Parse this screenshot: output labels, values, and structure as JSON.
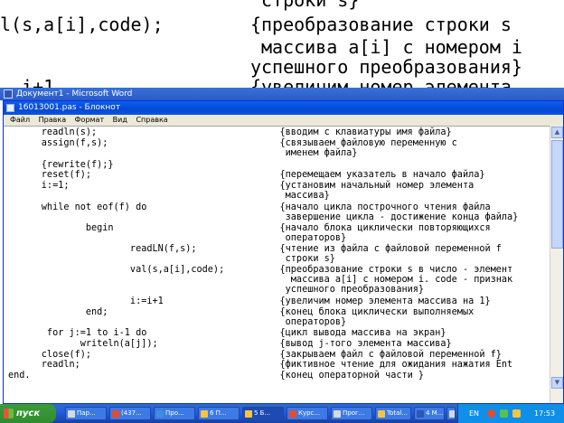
{
  "background_doc": {
    "lines": [
      "                        строки s}",
      "l(s,a[i],code);        {преобразование строки s",
      "                        массива a[i] с номером i",
      "                       успешного преобразования}",
      "  i+1                  {увеличим номер элемента"
    ]
  },
  "word_window": {
    "title": "Документ1 - Microsoft Word"
  },
  "notepad": {
    "title": "16013001.pas - Блокнот",
    "menu": [
      "Файл",
      "Правка",
      "Формат",
      "Вид",
      "Справка"
    ],
    "code_lines": [
      "      readln(s);                                 {вводим с клавиатуры имя файла}",
      "      assign(f,s);                               {связываем файловую переменную с",
      "                                                  именем файла}",
      "      {rewrite(f);}",
      "      reset(f);                                  {перемещаем указатель в начало файла}",
      "      i:=1;                                      {установим начальный номер элемента",
      "                                                  массива}",
      "      while not eof(f) do                        {начало цикла построчного чтения файла",
      "                                                  завершение цикла - достижение конца файла}",
      "              begin                              {начало блока циклически повторяющихся",
      "                                                  операторов}",
      "                      readLN(f,s);               {чтение из файла с файловой переменной f",
      "                                                  строки s}",
      "                      val(s,a[i],code);          {преобразование строки s в число - элемент",
      "                                                   массива a[i] с номером i. code - признак",
      "                                                  успешного преобразования}",
      "                      i:=i+1                     {увеличим номер элемента массива на 1}",
      "              end;                               {конец блока циклически выполняемых",
      "                                                  операторов}",
      "       for j:=1 to i-1 do                        {цикл вывода массива на экран}",
      "             writeln(a[j]);                      {вывод j-того элемента массива}",
      "      close(f);                                  {закрываем файл с файловой переменной f}",
      "      readln;                                    {фиктивное чтение для ожидания нажатия Ent",
      "end.                                             {конец операторной части }"
    ]
  },
  "taskbar": {
    "start_label": "пуск",
    "buttons": [
      {
        "label": "Пар...",
        "color": "#d9d9d9"
      },
      {
        "label": "(437...",
        "color": "#e44b2f"
      },
      {
        "label": "Про...",
        "color": "#3b8fdf"
      },
      {
        "label": "6 П...",
        "color": "#f5c542"
      },
      {
        "label": "5 Б...",
        "color": "#f5c542"
      },
      {
        "label": "Курс...",
        "color": "#e44b2f"
      },
      {
        "label": "Прог...",
        "color": "#d9d9d9"
      },
      {
        "label": "Total...",
        "color": "#f5c542"
      },
      {
        "label": "4 M...",
        "color": "#2f55b5"
      },
      {
        "label": "",
        "color": "#d9d9d9"
      }
    ],
    "tray": {
      "language": "EN",
      "time": "17:53"
    }
  }
}
